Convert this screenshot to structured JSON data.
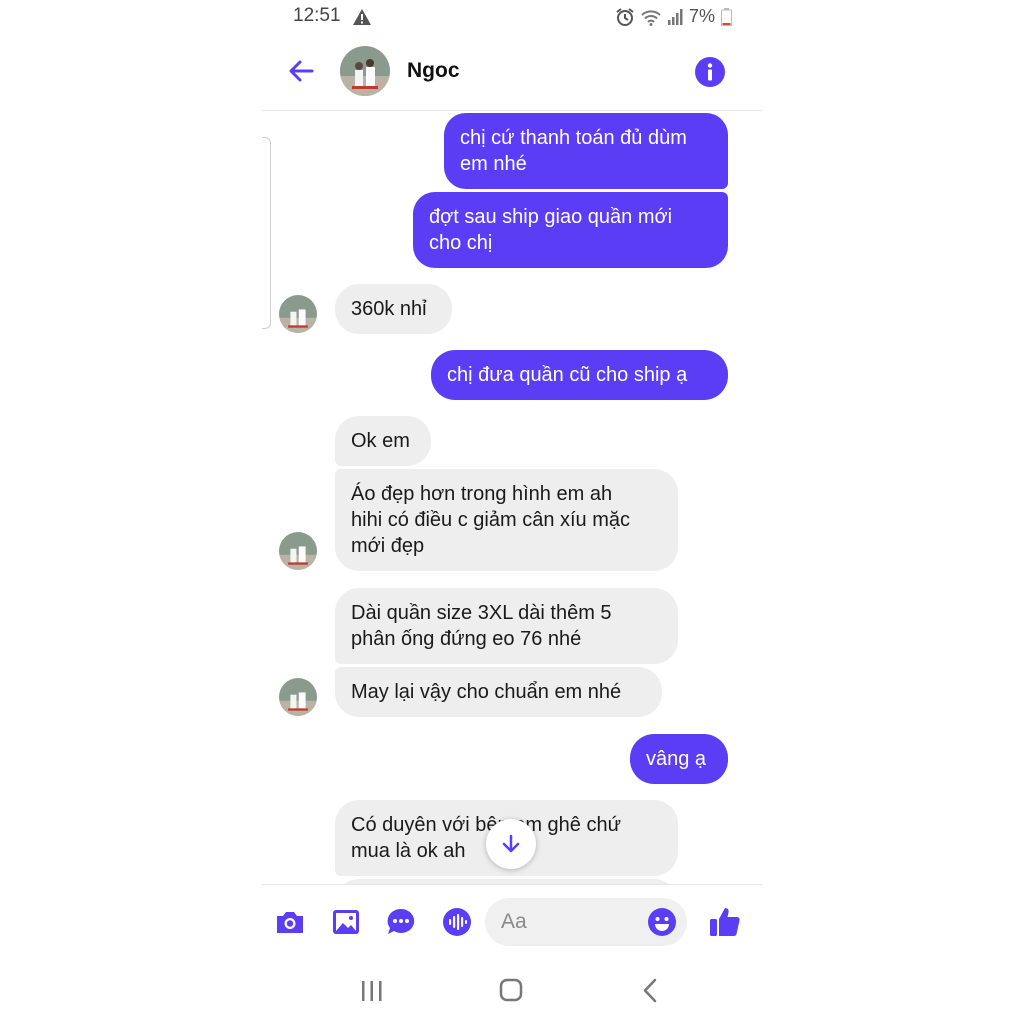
{
  "status": {
    "time": "12:51",
    "battery": "7%"
  },
  "header": {
    "contact_name": "Ngoc"
  },
  "messages": [
    {
      "dir": "out",
      "text": "chị cứ thanh toán đủ dùm\nem nhé"
    },
    {
      "dir": "out",
      "text": "đợt sau ship giao quần mới\ncho chị"
    },
    {
      "dir": "in",
      "text": "360k nhỉ"
    },
    {
      "dir": "out",
      "text": "chị đưa quần cũ cho ship ạ"
    },
    {
      "dir": "in",
      "text": "Ok em"
    },
    {
      "dir": "in",
      "text": "Áo đẹp hơn trong hình em ah\nhihi có điều c giảm cân xíu mặc\nmới đẹp"
    },
    {
      "dir": "in",
      "text": "Dài quần size 3XL dài thêm 5\nphân ống đứng eo 76 nhé"
    },
    {
      "dir": "in",
      "text": "May lại vậy cho chuẩn em nhé"
    },
    {
      "dir": "out",
      "text": "vâng ạ"
    },
    {
      "dir": "in",
      "text": "Có duyên với bên em ghê chứ\nmua là ok ah"
    }
  ],
  "composer": {
    "placeholder": "Aa"
  },
  "colors": {
    "accent": "#5b3df5",
    "incoming_bubble": "#eeeeee"
  },
  "icons": [
    "back-arrow-icon",
    "info-icon",
    "camera-icon",
    "gallery-icon",
    "more-icon",
    "voice-icon",
    "emoji-icon",
    "thumbs-up-icon",
    "scroll-down-arrow-icon"
  ]
}
